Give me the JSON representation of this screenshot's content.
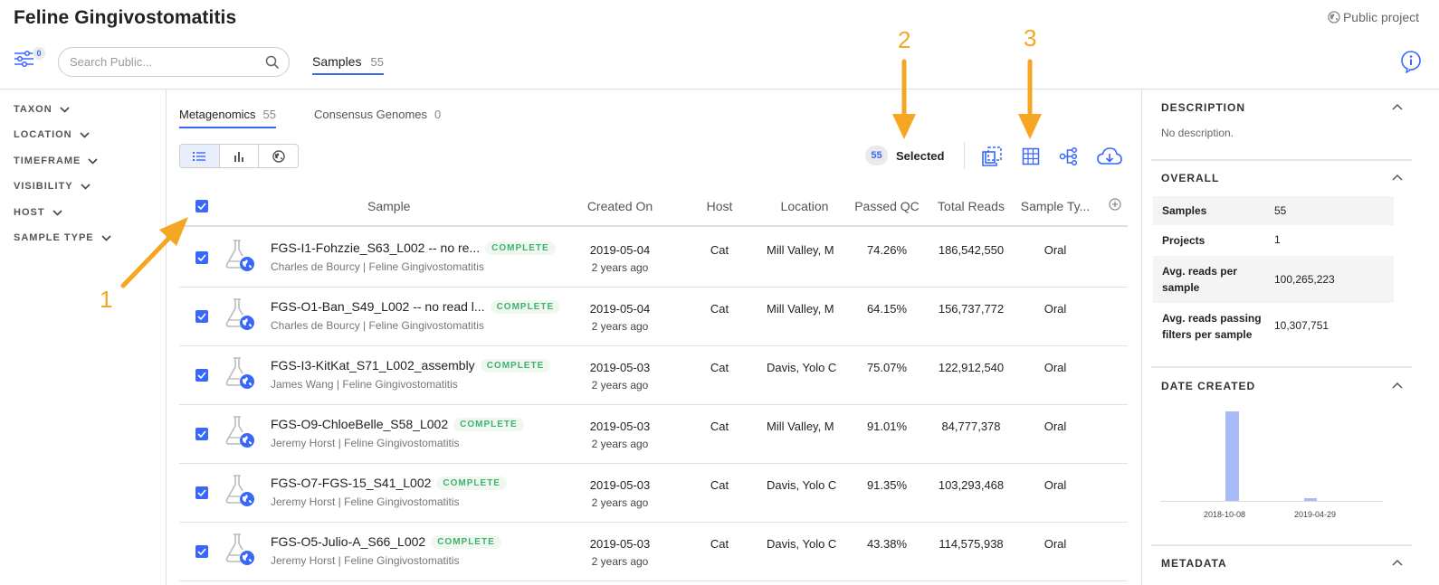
{
  "header": {
    "title": "Feline Gingivostomatitis",
    "public_label": "Public project",
    "filter_count": "0",
    "search_placeholder": "Search Public...",
    "tab_label": "Samples",
    "tab_count": "55"
  },
  "filters": [
    "TAXON",
    "LOCATION",
    "TIMEFRAME",
    "VISIBILITY",
    "HOST",
    "SAMPLE TYPE"
  ],
  "main": {
    "tabs": [
      {
        "label": "Metagenomics",
        "count": "55"
      },
      {
        "label": "Consensus Genomes",
        "count": "0"
      }
    ],
    "selected_count": "55",
    "selected_label": "Selected"
  },
  "table": {
    "columns": [
      "Sample",
      "Created On",
      "Host",
      "Location",
      "Passed QC",
      "Total Reads",
      "Sample Ty..."
    ],
    "rows": [
      {
        "name": "FGS-I1-Fohzzie_S63_L002 -- no re...",
        "status": "COMPLETE",
        "sub": "Charles de Bourcy | Feline Gingivostomatitis",
        "date": "2019-05-04",
        "ago": "2 years ago",
        "host": "Cat",
        "location": "Mill Valley, M",
        "qc": "74.26%",
        "reads": "186,542,550",
        "type": "Oral"
      },
      {
        "name": "FGS-O1-Ban_S49_L002 -- no read l...",
        "status": "COMPLETE",
        "sub": "Charles de Bourcy | Feline Gingivostomatitis",
        "date": "2019-05-04",
        "ago": "2 years ago",
        "host": "Cat",
        "location": "Mill Valley, M",
        "qc": "64.15%",
        "reads": "156,737,772",
        "type": "Oral"
      },
      {
        "name": "FGS-I3-KitKat_S71_L002_assembly",
        "status": "COMPLETE",
        "sub": "James Wang | Feline Gingivostomatitis",
        "date": "2019-05-03",
        "ago": "2 years ago",
        "host": "Cat",
        "location": "Davis, Yolo C",
        "qc": "75.07%",
        "reads": "122,912,540",
        "type": "Oral"
      },
      {
        "name": "FGS-O9-ChloeBelle_S58_L002",
        "status": "COMPLETE",
        "sub": "Jeremy Horst | Feline Gingivostomatitis",
        "date": "2019-05-03",
        "ago": "2 years ago",
        "host": "Cat",
        "location": "Mill Valley, M",
        "qc": "91.01%",
        "reads": "84,777,378",
        "type": "Oral"
      },
      {
        "name": "FGS-O7-FGS-15_S41_L002",
        "status": "COMPLETE",
        "sub": "Jeremy Horst | Feline Gingivostomatitis",
        "date": "2019-05-03",
        "ago": "2 years ago",
        "host": "Cat",
        "location": "Davis, Yolo C",
        "qc": "91.35%",
        "reads": "103,293,468",
        "type": "Oral"
      },
      {
        "name": "FGS-O5-Julio-A_S66_L002",
        "status": "COMPLETE",
        "sub": "Jeremy Horst | Feline Gingivostomatitis",
        "date": "2019-05-03",
        "ago": "2 years ago",
        "host": "Cat",
        "location": "Davis, Yolo C",
        "qc": "43.38%",
        "reads": "114,575,938",
        "type": "Oral"
      }
    ]
  },
  "right_panel": {
    "description_title": "DESCRIPTION",
    "description_text": "No description.",
    "overall_title": "OVERALL",
    "stats": [
      {
        "label": "Samples",
        "value": "55"
      },
      {
        "label": "Projects",
        "value": "1"
      },
      {
        "label": "Avg. reads per sample",
        "value": "100,265,223"
      },
      {
        "label": "Avg. reads passing filters per sample",
        "value": "10,307,751"
      }
    ],
    "date_created_title": "DATE CREATED",
    "histogram": {
      "labels": [
        "2018-10-08",
        "2019-04-29"
      ],
      "values": [
        54,
        1
      ]
    },
    "metadata_title": "METADATA"
  },
  "annotations": [
    "1",
    "2",
    "3"
  ],
  "colors": {
    "accent": "#3867fa",
    "annotation": "#f5a623",
    "complete": "#3cb371"
  }
}
